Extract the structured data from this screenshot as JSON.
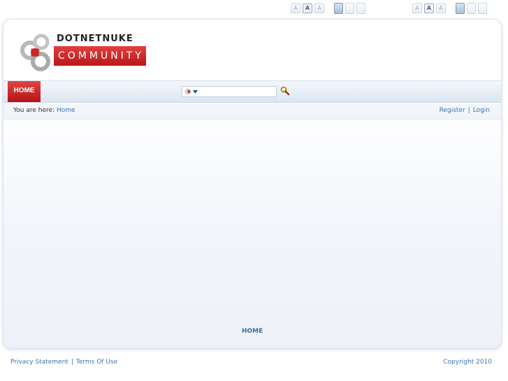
{
  "top_controls": {
    "font_sizes": [
      "A",
      "A",
      "A"
    ],
    "widths": [
      "",
      "",
      ""
    ]
  },
  "logo": {
    "line1": "DOTNETNUKE",
    "line2": "COMMUNITY"
  },
  "nav": {
    "home_label": "HOME"
  },
  "search": {
    "placeholder": "",
    "value": ""
  },
  "breadcrumb": {
    "label": "You are here:",
    "home_link": "Home"
  },
  "user": {
    "register": "Register",
    "separator": "|",
    "login": "Login"
  },
  "bottom_nav": {
    "home_label": "HOME"
  },
  "footer": {
    "privacy": "Privacy Statement",
    "separator": "|",
    "terms": "Terms Of Use",
    "copyright": "Copyright 2010"
  },
  "colors": {
    "accent_red": "#c41e1e",
    "link_blue": "#3a76b0"
  }
}
